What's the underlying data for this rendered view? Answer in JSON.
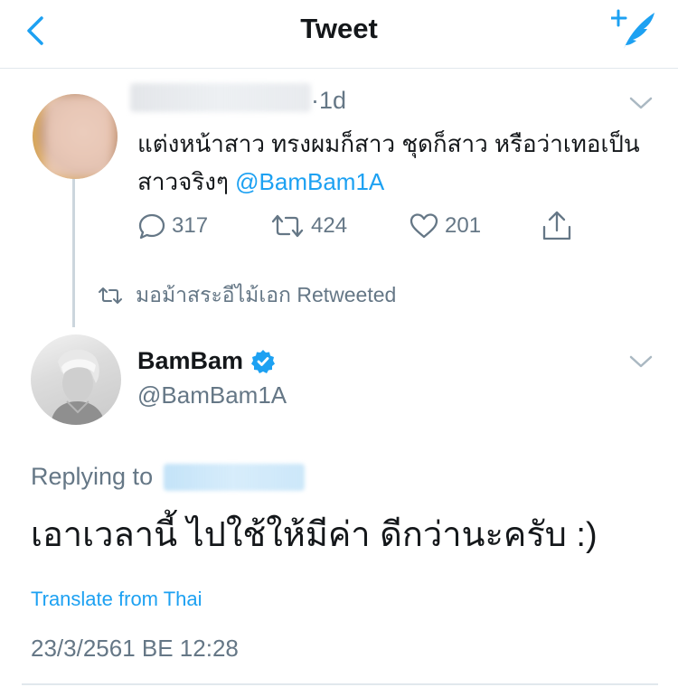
{
  "header": {
    "title": "Tweet",
    "back_icon": "chevron-left-icon",
    "compose_icon": "compose-quill-icon",
    "accent": "#1da1f2"
  },
  "original_tweet": {
    "time": "·1d",
    "text": "แต่งหน้าสาว ทรงผมก็สาว ชุดก็สาว หรือว่าเทอเป็นสาวจริงๆ ",
    "mention": "@BamBam1A",
    "actions": {
      "replies": "317",
      "retweets": "424",
      "likes": "201"
    }
  },
  "retweet_context": {
    "text": "มอม้าสระอีไม้เอก Retweeted"
  },
  "reply_tweet": {
    "name": "BamBam",
    "handle": "@BamBam1A",
    "verified": true,
    "replying_to": "Replying to",
    "text": "เอาเวลานี้ ไปใช้ให้มีค่า ดีกว่านะครับ :)",
    "translate": "Translate from Thai",
    "timestamp": "23/3/2561 BE 12:28"
  },
  "colors": {
    "text": "#14171a",
    "secondary": "#657786",
    "link": "#1da1f2",
    "divider": "#e1e8ed"
  }
}
